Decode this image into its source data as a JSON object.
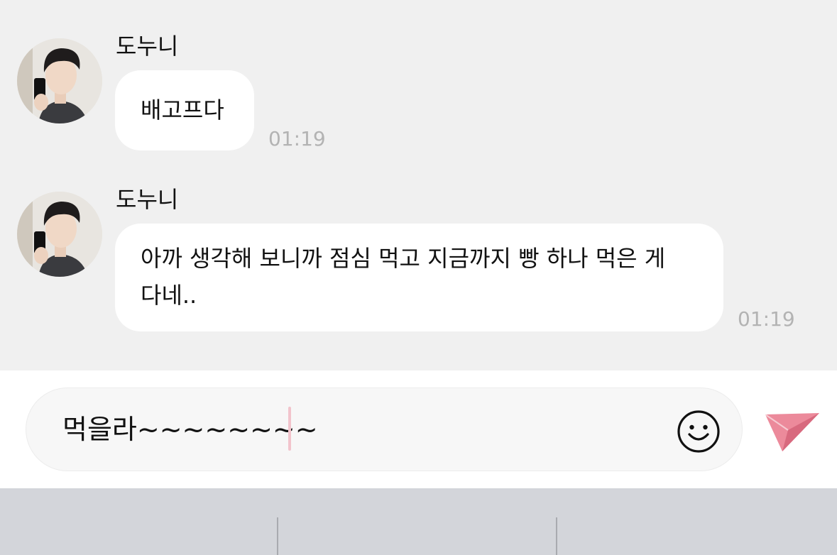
{
  "messages": [
    {
      "sender": "도누니",
      "text": "배고프다",
      "time": "01:19"
    },
    {
      "sender": "도누니",
      "text_line1": "아까 생각해 보니까 점심 먹고 지금까지 빵 하나 먹은 게",
      "text_line2": "다네..",
      "time": "01:19"
    }
  ],
  "composer": {
    "input_value": "먹을라~~~~~~~~",
    "emoji_icon": "smiley-icon",
    "send_icon": "paper-plane-icon",
    "send_color": "#ec8a9b",
    "caret_color": "#f2c4cc"
  },
  "colors": {
    "chat_background": "#f0f0f0",
    "bubble": "#ffffff",
    "timestamp": "#b3b3b3",
    "keyboard": "#d3d5da"
  }
}
